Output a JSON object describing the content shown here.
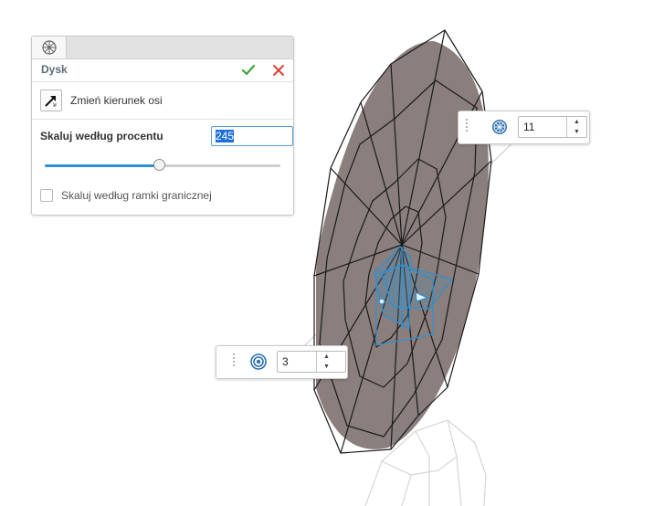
{
  "dialog": {
    "title": "Dysk",
    "tab_icon": "disc-feature-icon",
    "ok_icon": "check-icon",
    "cancel_icon": "close-icon",
    "change_direction_label": "Zmień kierunek osi",
    "scale_label": "Skaluj według procentu",
    "scale_value": "245",
    "slider_fraction": 0.49,
    "bounding_box_label": "Skaluj według ramki granicznej",
    "bounding_box_checked": false
  },
  "spin_segments": {
    "icon": "segments-icon",
    "value": "11"
  },
  "spin_rings": {
    "icon": "rings-icon",
    "value": "3"
  },
  "colors": {
    "accent": "#2f8fd6",
    "ok": "#3aa63a",
    "cancel": "#d9423a",
    "disc_fill": "#8a7f7c",
    "handle": "#3a8ec7"
  }
}
